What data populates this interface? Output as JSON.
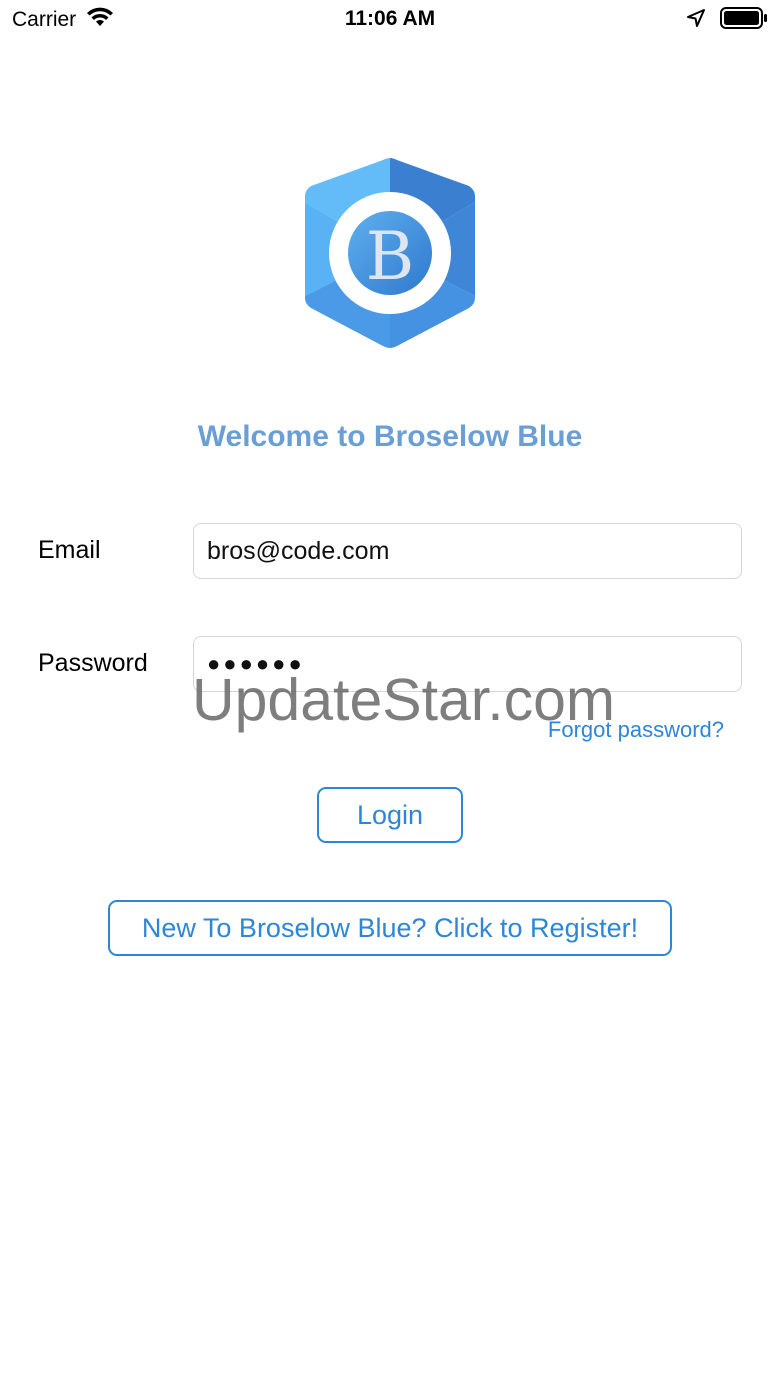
{
  "status_bar": {
    "carrier": "Carrier",
    "time": "11:06 AM",
    "icons": [
      "wifi-icon",
      "location-arrow-icon",
      "battery-icon"
    ]
  },
  "logo": {
    "letter": "B",
    "colors": {
      "light": "#5fb7f5",
      "mid": "#4d9ae6",
      "dark": "#3a7fd0",
      "ring": "#ffffff"
    }
  },
  "welcome": {
    "title": "Welcome to Broselow Blue"
  },
  "form": {
    "email_label": "Email",
    "email_value": "bros@code.com",
    "password_label": "Password",
    "password_value": "●●●●●●",
    "forgot_label": "Forgot password?"
  },
  "buttons": {
    "login": "Login",
    "register": "New To Broselow Blue? Click to Register!"
  },
  "watermark": {
    "text": "UpdateStar.com"
  },
  "colors": {
    "accent": "#2e86d6",
    "title": "#6a9fd6",
    "field_border": "#d6d6d6"
  }
}
